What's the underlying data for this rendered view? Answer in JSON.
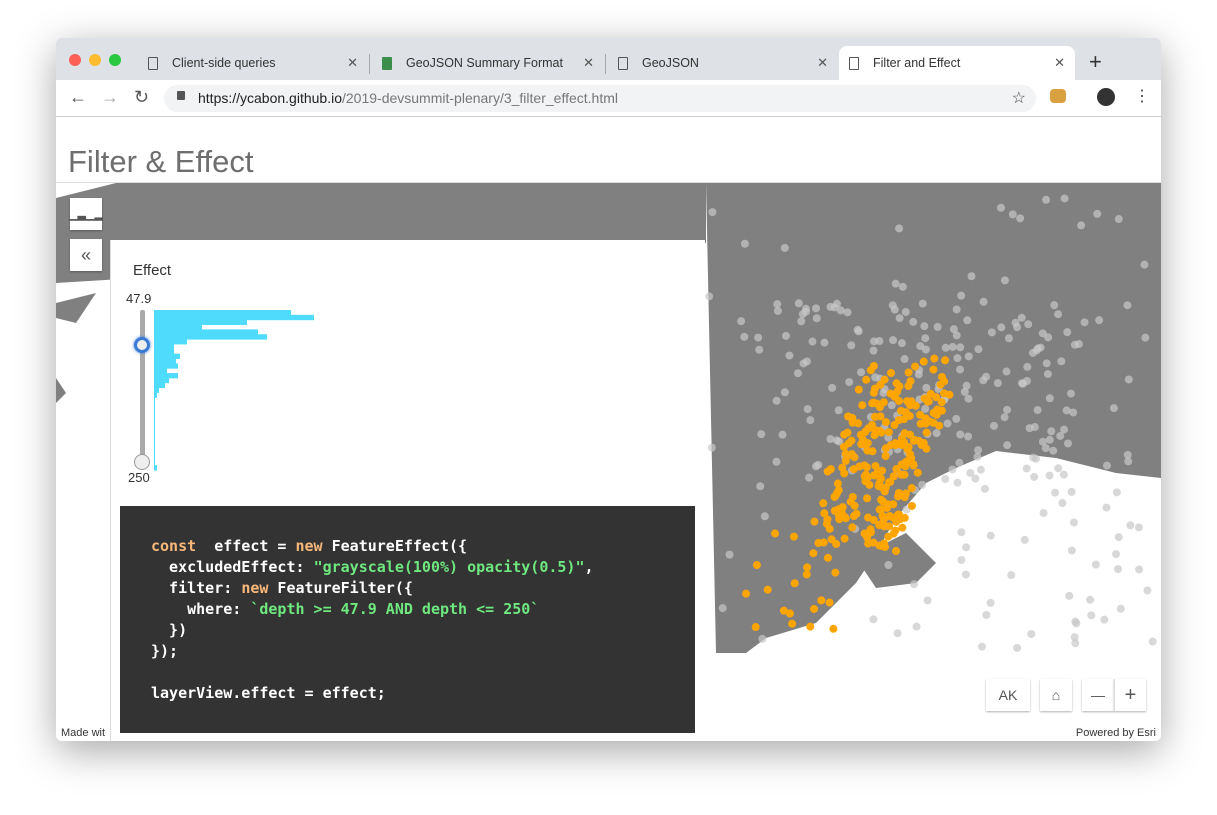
{
  "browser": {
    "tabs": [
      {
        "label": "Client-side queries",
        "icon": "page-icon"
      },
      {
        "label": "GeoJSON Summary Format",
        "icon": "geojson-favicon"
      },
      {
        "label": "GeoJSON",
        "icon": "page-icon"
      },
      {
        "label": "Filter and Effect",
        "icon": "page-icon",
        "active": true
      }
    ],
    "url_host": "https://ycabon.github.io",
    "url_path": "/2019-devsummit-plenary/3_filter_effect.html"
  },
  "page": {
    "title": "Filter & Effect"
  },
  "panel": {
    "heading": "Effect",
    "slider_min_label": "47.9",
    "slider_max_label": "250",
    "slider_value": 47.9,
    "slider_max": 250,
    "histogram_bins": [
      137,
      160,
      93,
      48,
      104,
      113,
      33,
      20,
      20,
      26,
      22,
      24,
      13,
      24,
      15,
      11,
      5,
      3,
      1,
      1,
      1,
      1,
      1,
      1,
      1,
      1,
      1,
      1,
      1,
      1,
      1,
      1,
      3
    ],
    "histogram_color": "#4fdcfc"
  },
  "code": {
    "lines": [
      [
        [
          "k",
          "const"
        ],
        [
          "",
          "  effect = "
        ],
        [
          "k",
          "new"
        ],
        [
          "",
          " FeatureEffect({"
        ]
      ],
      [
        [
          "",
          "  excludedEffect: "
        ],
        [
          "s",
          "\"grayscale(100%) opacity(0.5)\""
        ],
        [
          "",
          ","
        ]
      ],
      [
        [
          "",
          "  filter: "
        ],
        [
          "k",
          "new"
        ],
        [
          "",
          " FeatureFilter({"
        ]
      ],
      [
        [
          "",
          "    where: "
        ],
        [
          "s",
          "`depth >= 47.9 AND depth <= 250`"
        ]
      ],
      [
        [
          "",
          "  })"
        ]
      ],
      [
        [
          "",
          "});"
        ]
      ],
      [
        [
          "",
          ""
        ]
      ],
      [
        [
          "",
          "layerView.effect = effect;"
        ]
      ]
    ]
  },
  "map": {
    "land_color": "#808080",
    "included_color": "#ffa500",
    "excluded_color": "#c8c8c8",
    "controls": {
      "ak_label": "AK",
      "home": "home-icon",
      "zoom_out": "—",
      "zoom_in": "+"
    },
    "attribution_left": "Made wit",
    "attribution_right": "Powered by Esri"
  }
}
